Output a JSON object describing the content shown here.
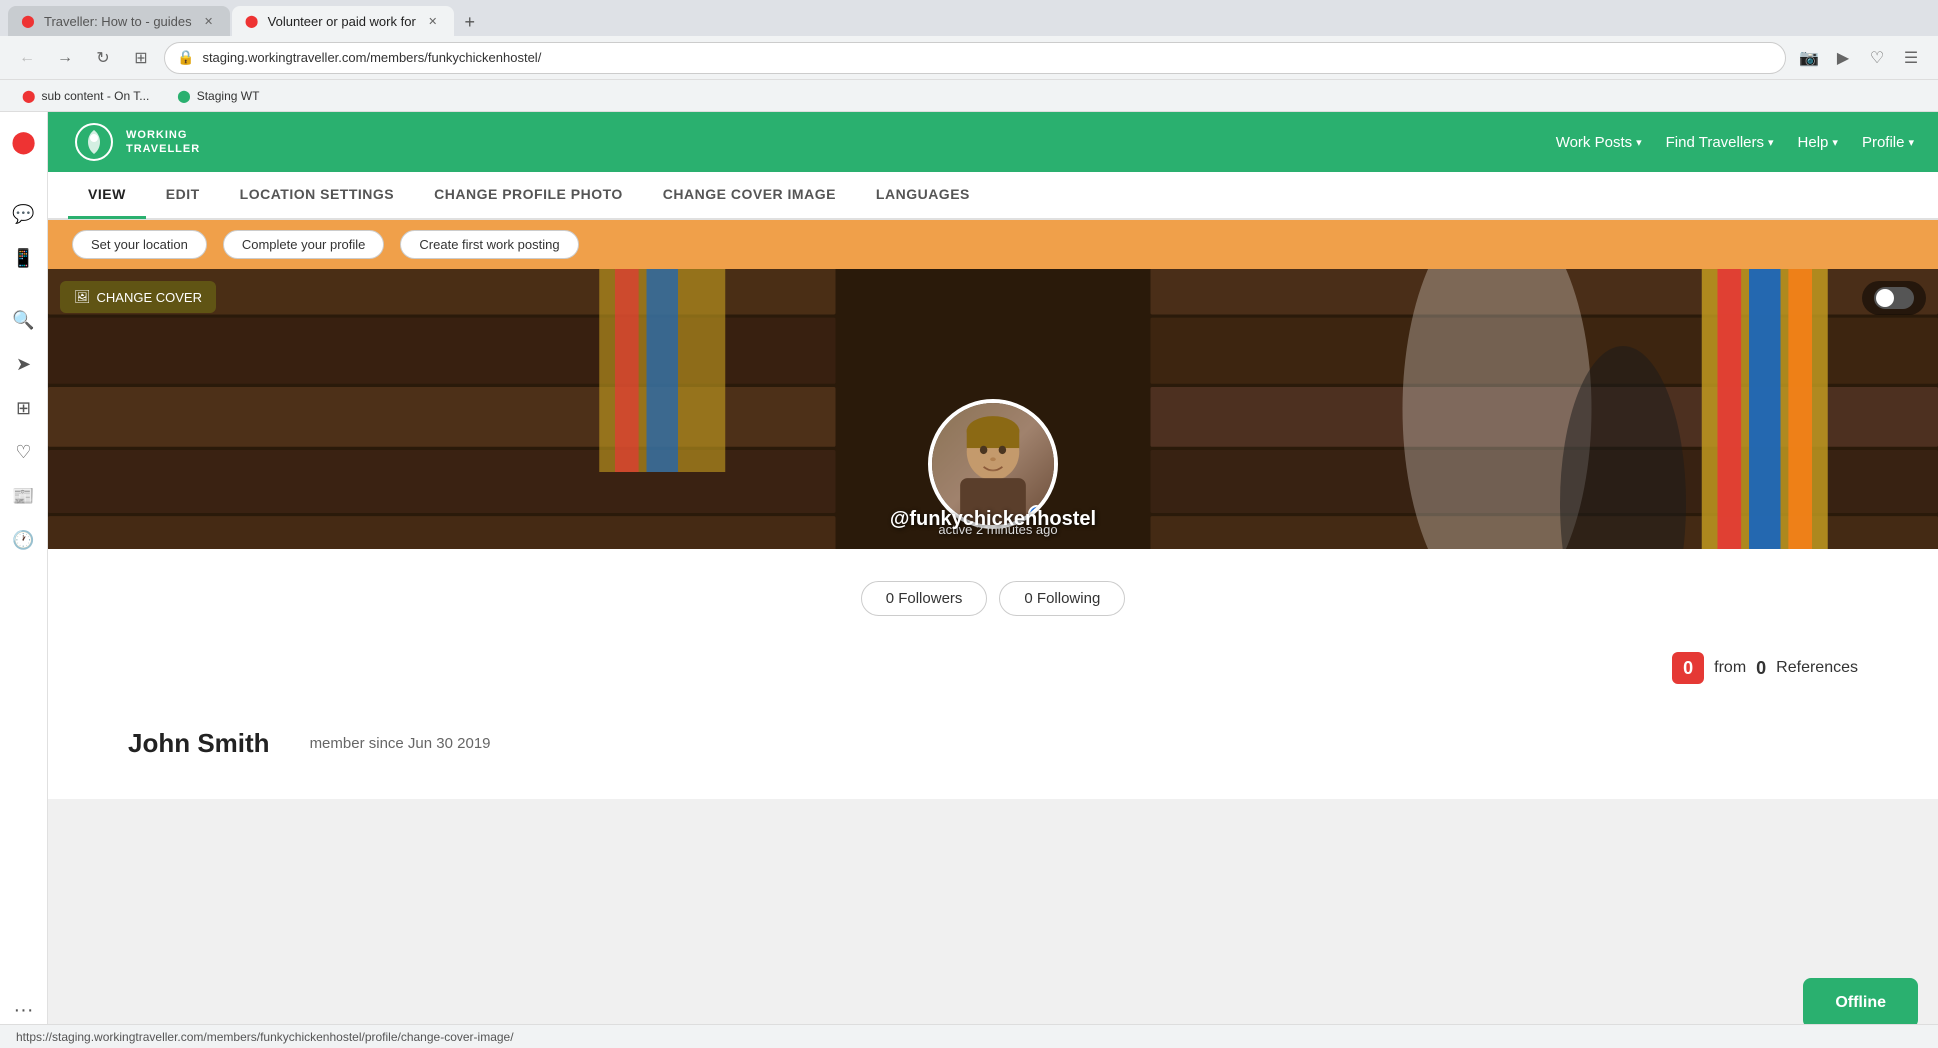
{
  "browser": {
    "tabs": [
      {
        "id": "tab1",
        "label": "Traveller: How to - guides",
        "favicon": "🅾",
        "active": false
      },
      {
        "id": "tab2",
        "label": "Volunteer or paid work for",
        "favicon": "🅾",
        "active": true
      }
    ],
    "new_tab_label": "+",
    "address": "staging.workingtraveller.com/members/funkychickenhostel/",
    "bookmarks": [
      {
        "label": "sub content - On T..."
      },
      {
        "label": "Staging WT"
      }
    ]
  },
  "sidebar": {
    "icons": [
      {
        "name": "opera-logo",
        "symbol": "⬤",
        "active": false
      },
      {
        "name": "messenger",
        "symbol": "💬",
        "active": false
      },
      {
        "name": "whatsapp",
        "symbol": "📱",
        "active": false
      },
      {
        "name": "search",
        "symbol": "🔍",
        "active": false
      },
      {
        "name": "flow",
        "symbol": "➤",
        "active": false
      },
      {
        "name": "apps",
        "symbol": "⊞",
        "active": false
      },
      {
        "name": "favorites",
        "symbol": "♡",
        "active": false
      },
      {
        "name": "news",
        "symbol": "📰",
        "active": false
      },
      {
        "name": "history",
        "symbol": "🕐",
        "active": false
      }
    ]
  },
  "site_header": {
    "logo_text_line1": "WORKING",
    "logo_text_line2": "TRAVELLER",
    "nav_items": [
      {
        "label": "Work Posts",
        "has_dropdown": true
      },
      {
        "label": "Find Travellers",
        "has_dropdown": true
      },
      {
        "label": "Help",
        "has_dropdown": true
      },
      {
        "label": "Profile",
        "has_dropdown": true
      }
    ]
  },
  "profile_tabs": [
    {
      "label": "VIEW",
      "active": true
    },
    {
      "label": "EDIT",
      "active": false
    },
    {
      "label": "LOCATION SETTINGS",
      "active": false
    },
    {
      "label": "CHANGE PROFILE PHOTO",
      "active": false
    },
    {
      "label": "CHANGE COVER IMAGE",
      "active": false
    },
    {
      "label": "LANGUAGES",
      "active": false
    }
  ],
  "action_bar": {
    "buttons": [
      {
        "label": "Set your location"
      },
      {
        "label": "Complete your profile"
      },
      {
        "label": "Create first work posting"
      }
    ]
  },
  "cover": {
    "change_cover_label": "CHANGE COVER",
    "username": "@funkychickenhostel",
    "active_status": "active 2 minutes ago"
  },
  "social": {
    "followers_count": "0",
    "followers_label": "Followers",
    "following_count": "0",
    "following_label": "Following"
  },
  "references": {
    "badge_count": "0",
    "from_label": "from",
    "count": "0",
    "label": "References"
  },
  "member": {
    "name": "John Smith",
    "since_label": "member since Jun 30 2019"
  },
  "offline_btn": {
    "label": "Offline"
  },
  "status_bar": {
    "url": "https://staging.workingtraveller.com/members/funkychickenhostel/profile/change-cover-image/"
  }
}
